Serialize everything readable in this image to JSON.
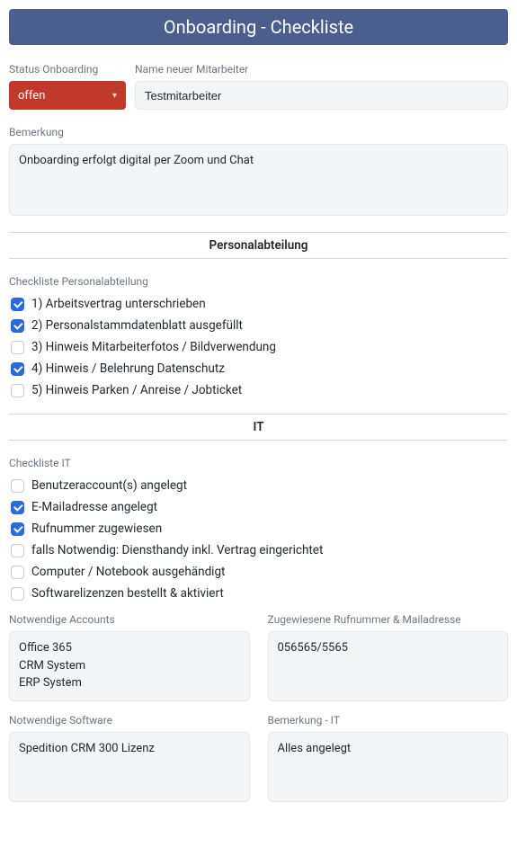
{
  "header": {
    "title": "Onboarding - Checkliste"
  },
  "status": {
    "label": "Status Onboarding",
    "value": "offen"
  },
  "name": {
    "label": "Name neuer Mitarbeiter",
    "value": "Testmitarbeiter"
  },
  "remark": {
    "label": "Bemerkung",
    "value": "Onboarding erfolgt digital per Zoom und Chat"
  },
  "sections": {
    "hr": {
      "title": "Personalabteilung",
      "checklist_label": "Checkliste Personalabteilung",
      "items": [
        {
          "label": "1) Arbeitsvertrag unterschrieben",
          "checked": true
        },
        {
          "label": "2) Personalstammdatenblatt ausgefüllt",
          "checked": true
        },
        {
          "label": "3) Hinweis Mitarbeiterfotos / Bildverwendung",
          "checked": false
        },
        {
          "label": "4) Hinweis / Belehrung Datenschutz",
          "checked": true
        },
        {
          "label": "5) Hinweis Parken / Anreise / Jobticket",
          "checked": false
        }
      ]
    },
    "it": {
      "title": "IT",
      "checklist_label": "Checkliste IT",
      "items": [
        {
          "label": "Benutzeraccount(s) angelegt",
          "checked": false
        },
        {
          "label": "E-Mailadresse angelegt",
          "checked": true
        },
        {
          "label": "Rufnummer zugewiesen",
          "checked": true
        },
        {
          "label": "falls Notwendig: Diensthandy inkl. Vertrag eingerichtet",
          "checked": false
        },
        {
          "label": "Computer / Notebook ausgehändigt",
          "checked": false
        },
        {
          "label": "Softwarelizenzen bestellt & aktiviert",
          "checked": false
        }
      ],
      "accounts": {
        "label": "Notwendige Accounts",
        "value": "Office 365\nCRM System\nERP System"
      },
      "phone_mail": {
        "label": "Zugewiesene Rufnummer & Mailadresse",
        "value": "056565/5565"
      },
      "software": {
        "label": "Notwendige Software",
        "value": "Spedition CRM 300 Lizenz"
      },
      "remark_it": {
        "label": "Bemerkung - IT",
        "value": "Alles angelegt"
      }
    }
  }
}
